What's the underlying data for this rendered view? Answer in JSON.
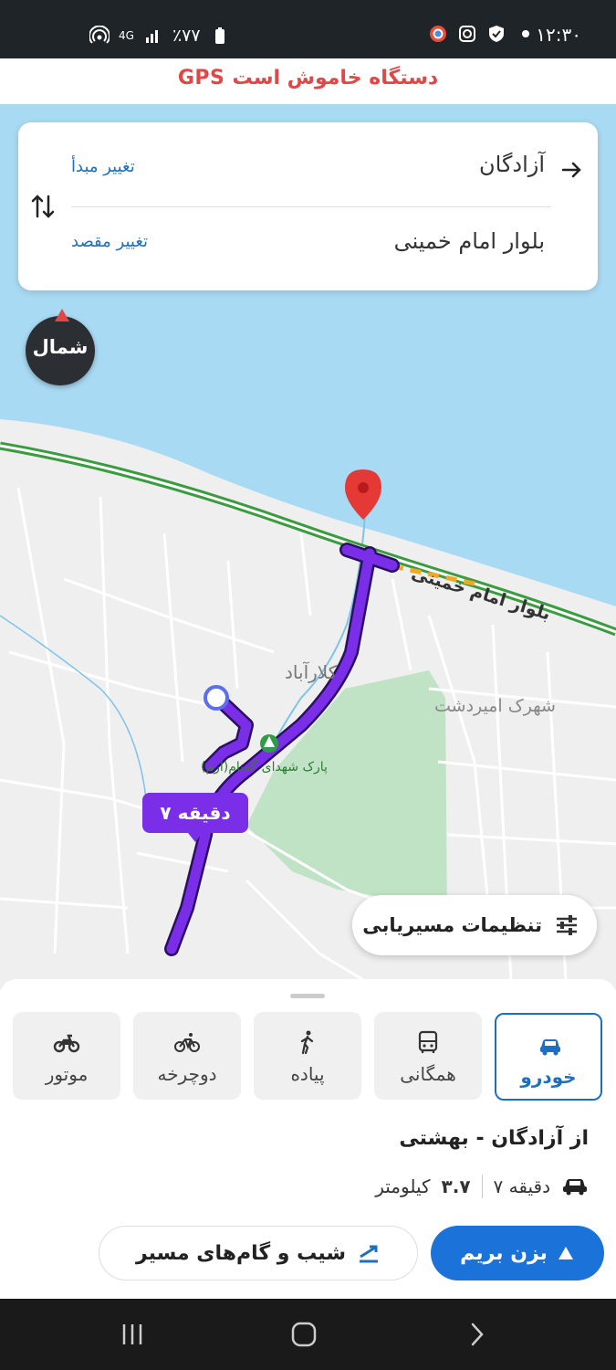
{
  "status_bar": {
    "time": "۱۲:۳۰",
    "battery": "٪۷۷",
    "network": "4G"
  },
  "gps_banner": "GPS دستگاه خاموش است",
  "route_card": {
    "origin": "آزادگان",
    "origin_change": "تغییر مبدأ",
    "destination": "بلوار امام خمینی",
    "destination_change": "تغییر مقصد"
  },
  "compass_label": "شمال",
  "map": {
    "road_label": "بلوار امام خمینی",
    "area_label_1": "کلارآباد",
    "area_label_2": "شهرک امیردشت",
    "park_label": "پارک شهدای گمنام(ارم)",
    "colors": {
      "sea": "#a9daf3",
      "land": "#efefef",
      "park": "#bfe3c4",
      "route": "#7b2ee8",
      "highway": "#3a9c3f"
    }
  },
  "eta_bubble": "۷ دقیقه",
  "routing_settings_label": "تنظیمات مسیریابی",
  "modes": [
    {
      "key": "car",
      "label": "خودرو",
      "active": true
    },
    {
      "key": "transit",
      "label": "همگانی",
      "active": false
    },
    {
      "key": "walk",
      "label": "پیاده",
      "active": false
    },
    {
      "key": "bike",
      "label": "دوچرخه",
      "active": false
    },
    {
      "key": "motor",
      "label": "موتور",
      "active": false
    }
  ],
  "route_summary": {
    "title": "از آزادگان - بهشتی",
    "duration": "۷ دقیقه",
    "distance_value": "۳.۷",
    "distance_unit": "کیلومتر"
  },
  "actions": {
    "go_label": "بزن بریم",
    "steps_label": "شیب و گام‌های مسیر"
  }
}
